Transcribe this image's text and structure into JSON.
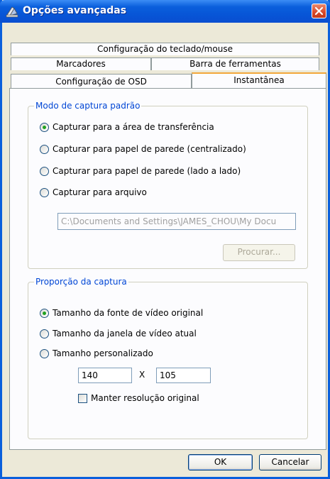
{
  "window": {
    "title": "Opções avançadas"
  },
  "tabs": {
    "row1": [
      "Configuração do teclado/mouse"
    ],
    "row2": [
      "Marcadores",
      "Barra de ferramentas"
    ],
    "row3": [
      "Configuração de OSD",
      "Instantânea"
    ]
  },
  "capture_mode": {
    "title": "Modo de captura padrão",
    "options": [
      {
        "label": "Capturar para a área de transferência",
        "checked": true
      },
      {
        "label": "Capturar para papel de parede (centralizado)",
        "checked": false
      },
      {
        "label": "Capturar para papel de parede (lado a lado)",
        "checked": false
      },
      {
        "label": "Capturar para arquivo",
        "checked": false
      }
    ],
    "path_value": "C:\\Documents and Settings\\JAMES_CHOU\\My Docu",
    "browse_label": "Procurar..."
  },
  "capture_ratio": {
    "title": "Proporção da captura",
    "options": [
      {
        "label": "Tamanho da fonte de vídeo original",
        "checked": true
      },
      {
        "label": "Tamanho da janela de vídeo atual",
        "checked": false
      },
      {
        "label": "Tamanho personalizado",
        "checked": false
      }
    ],
    "width": "140",
    "times": "X",
    "height": "105",
    "keep_label": "Manter resolução original",
    "keep_checked": false
  },
  "footer": {
    "ok_label": "OK",
    "cancel_label": "Cancelar"
  },
  "icons": {
    "app": "app-icon",
    "close": "close-icon"
  },
  "colors": {
    "titlebar": "#0a5fdc",
    "group_title": "#0046d5",
    "tab_highlight": "#f3a83a",
    "radio_dot": "#21a121"
  }
}
